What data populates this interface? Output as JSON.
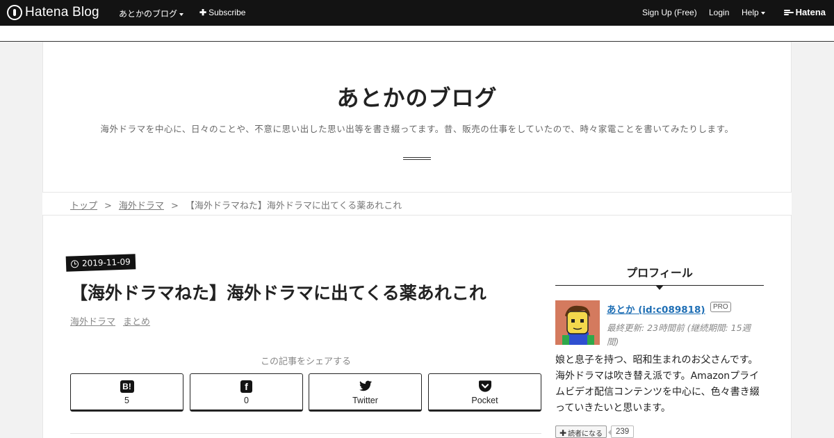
{
  "globalnav": {
    "logo_text": "Hatena Blog",
    "blog_menu_label": "あとかのブログ",
    "subscribe_label": "Subscribe",
    "signup_label": "Sign Up (Free)",
    "login_label": "Login",
    "help_label": "Help",
    "hatena_label": "Hatena"
  },
  "blog": {
    "title": "あとかのブログ",
    "description": "海外ドラマを中心に、日々のことや、不意に思い出した思い出等を書き綴ってます。昔、販売の仕事をしていたので、時々家電ことを書いてみたりします。"
  },
  "breadcrumb": {
    "items": [
      "トップ",
      "海外ドラマ"
    ],
    "current": "【海外ドラマねた】海外ドラマに出てくる薬あれこれ",
    "separator": ">"
  },
  "article": {
    "date": "2019-11-09",
    "title": "【海外ドラマねた】海外ドラマに出てくる薬あれこれ",
    "categories": [
      "海外ドラマ",
      "まとめ"
    ],
    "share_caption": "この記事をシェアする",
    "share_buttons": [
      {
        "icon": "hatena-bookmark-icon",
        "label": "5"
      },
      {
        "icon": "facebook-icon",
        "label": "0"
      },
      {
        "icon": "twitter-icon",
        "label": "Twitter"
      },
      {
        "icon": "pocket-icon",
        "label": "Pocket"
      }
    ]
  },
  "sidebar": {
    "heading": "プロフィール",
    "profile": {
      "name": "あとか (id:c089818)",
      "badge": "PRO",
      "last_updated": "最終更新: 23時間前 (継続期間: 15週間)",
      "description": "娘と息子を持つ、昭和生まれのお父さんです。海外ドラマは吹き替え派です。Amazonプライムビデオ配信コンテンツを中心に、色々書き綴っていきたいと思います。",
      "reader_button": "読者になる",
      "reader_count": "239"
    }
  },
  "colors": {
    "nav_bg": "#131313",
    "link_blue": "#1f6fb5",
    "page_bg": "#f2f2f2"
  }
}
